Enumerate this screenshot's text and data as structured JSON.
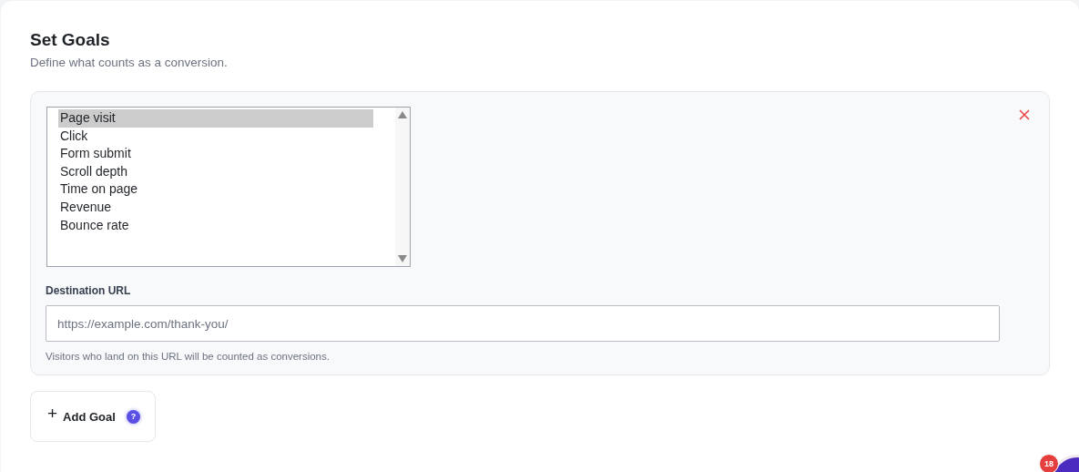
{
  "header": {
    "title": "Set Goals",
    "subtitle": "Define what counts as a conversion."
  },
  "goal": {
    "goal_types": [
      {
        "label": "Page visit",
        "selected": true
      },
      {
        "label": "Click",
        "selected": false
      },
      {
        "label": "Form submit",
        "selected": false
      },
      {
        "label": "Scroll depth",
        "selected": false
      },
      {
        "label": "Time on page",
        "selected": false
      },
      {
        "label": "Revenue",
        "selected": false
      },
      {
        "label": "Bounce rate",
        "selected": false
      }
    ],
    "field_label": "Destination URL",
    "placeholder": "https://example.com/thank-you/",
    "help": "Visitors who land on this URL will be counted as conversions."
  },
  "add_button": {
    "icon": "+",
    "label": "Add Goal",
    "help_badge": "?"
  },
  "notification_badge": "18"
}
